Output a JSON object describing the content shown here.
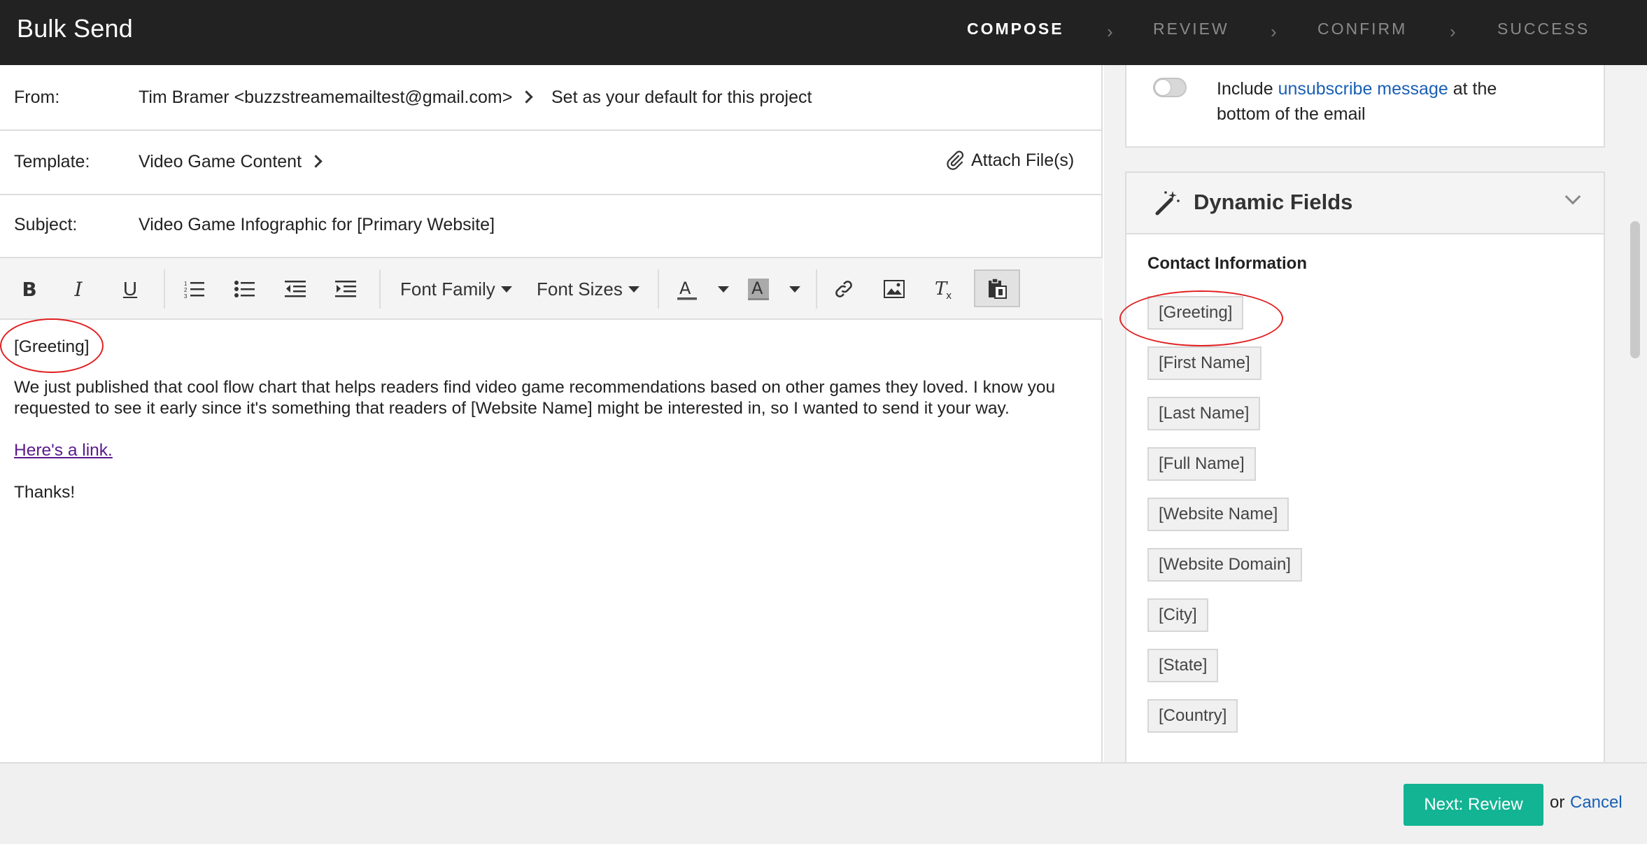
{
  "app": {
    "title": "Bulk Send"
  },
  "steps": [
    {
      "label": "COMPOSE",
      "active": true
    },
    {
      "label": "REVIEW",
      "active": false
    },
    {
      "label": "CONFIRM",
      "active": false
    },
    {
      "label": "SUCCESS",
      "active": false
    }
  ],
  "compose": {
    "from_label": "From:",
    "from_value": "Tim Bramer <buzzstreamemailtest@gmail.com>",
    "set_default_link": "Set as your default for this project",
    "template_label": "Template:",
    "template_value": "Video Game Content",
    "attach_label": "Attach File(s)",
    "subject_label": "Subject:",
    "subject_value": "Video Game Infographic for [Primary Website]"
  },
  "toolbar": {
    "font_family": "Font Family",
    "font_sizes": "Font Sizes"
  },
  "body": {
    "greeting": "[Greeting]",
    "paragraph": "We just published that cool flow chart that helps readers find video game recommendations based on other games they loved. I know you requested to see it early since it's something that readers of [Website Name] might be interested in, so I wanted to send it your way.",
    "link_text": "Here's a link.",
    "signoff": "Thanks!"
  },
  "sidebar": {
    "unsub_prefix": "Include ",
    "unsub_link": "unsubscribe message",
    "unsub_suffix": " at the bottom of the email",
    "unsub_enabled": false,
    "dynamic_fields_title": "Dynamic Fields",
    "contact_info_title": "Contact Information",
    "fields": [
      "[Greeting]",
      "[First Name]",
      "[Last Name]",
      "[Full Name]",
      "[Website Name]",
      "[Website Domain]",
      "[City]",
      "[State]",
      "[Country]"
    ]
  },
  "footer": {
    "next_label": "Next: Review",
    "or_text": "or",
    "cancel_label": "Cancel"
  },
  "colors": {
    "accent_green": "#13b493",
    "link_blue": "#1a5fb4",
    "annotation_red": "#e02020",
    "topbar": "#222222"
  }
}
